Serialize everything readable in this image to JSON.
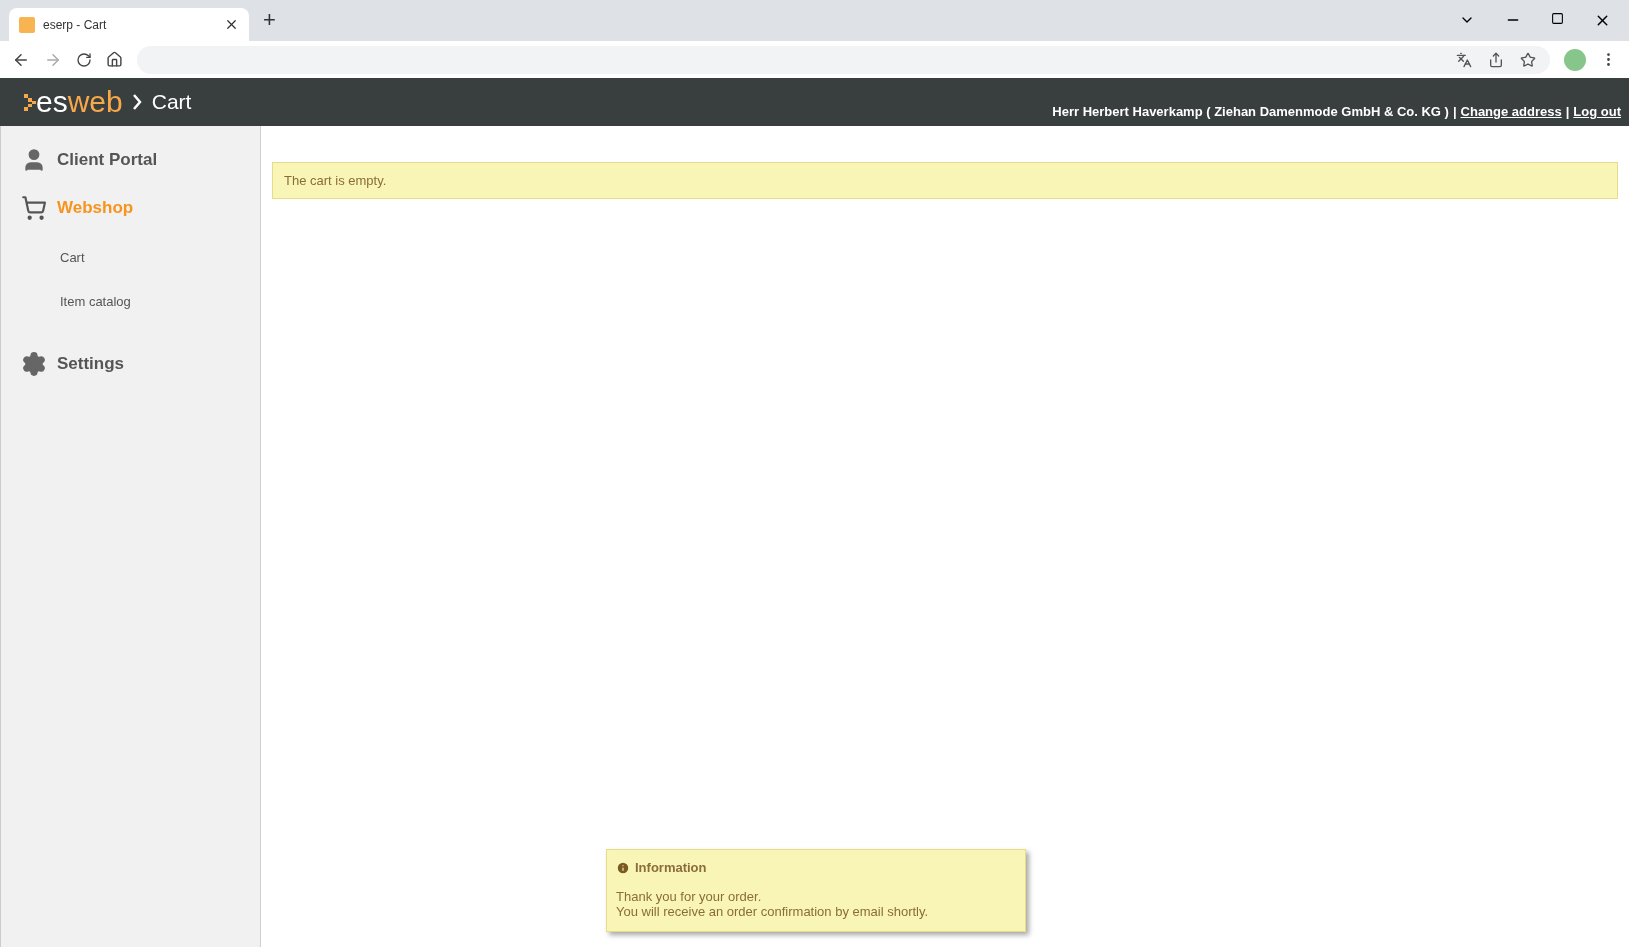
{
  "browser": {
    "tab_title": "eserp - Cart",
    "new_tab": "+"
  },
  "header": {
    "logo": {
      "first": "es",
      "second": "web"
    },
    "breadcrumb": "Cart",
    "user": "Herr Herbert Haverkamp ( Ziehan Damenmode GmbH & Co. KG )",
    "separator": "|",
    "links": [
      "Change address",
      "Log out"
    ]
  },
  "sidebar": {
    "sections": [
      {
        "kind": "user",
        "label": "Client Portal",
        "selected": false
      },
      {
        "kind": "cart",
        "label": "Webshop",
        "selected": true,
        "children": [
          {
            "label": "Cart",
            "selected": false
          },
          {
            "label": "Item catalog",
            "selected": false
          }
        ]
      },
      {
        "kind": "settings",
        "label": "Settings",
        "selected": false
      }
    ]
  },
  "alert": {
    "text": "The cart is empty."
  },
  "notification": {
    "title": "Information",
    "lines": [
      "Thank you for your order.",
      "You will receive an order confirmation by email shortly."
    ]
  }
}
